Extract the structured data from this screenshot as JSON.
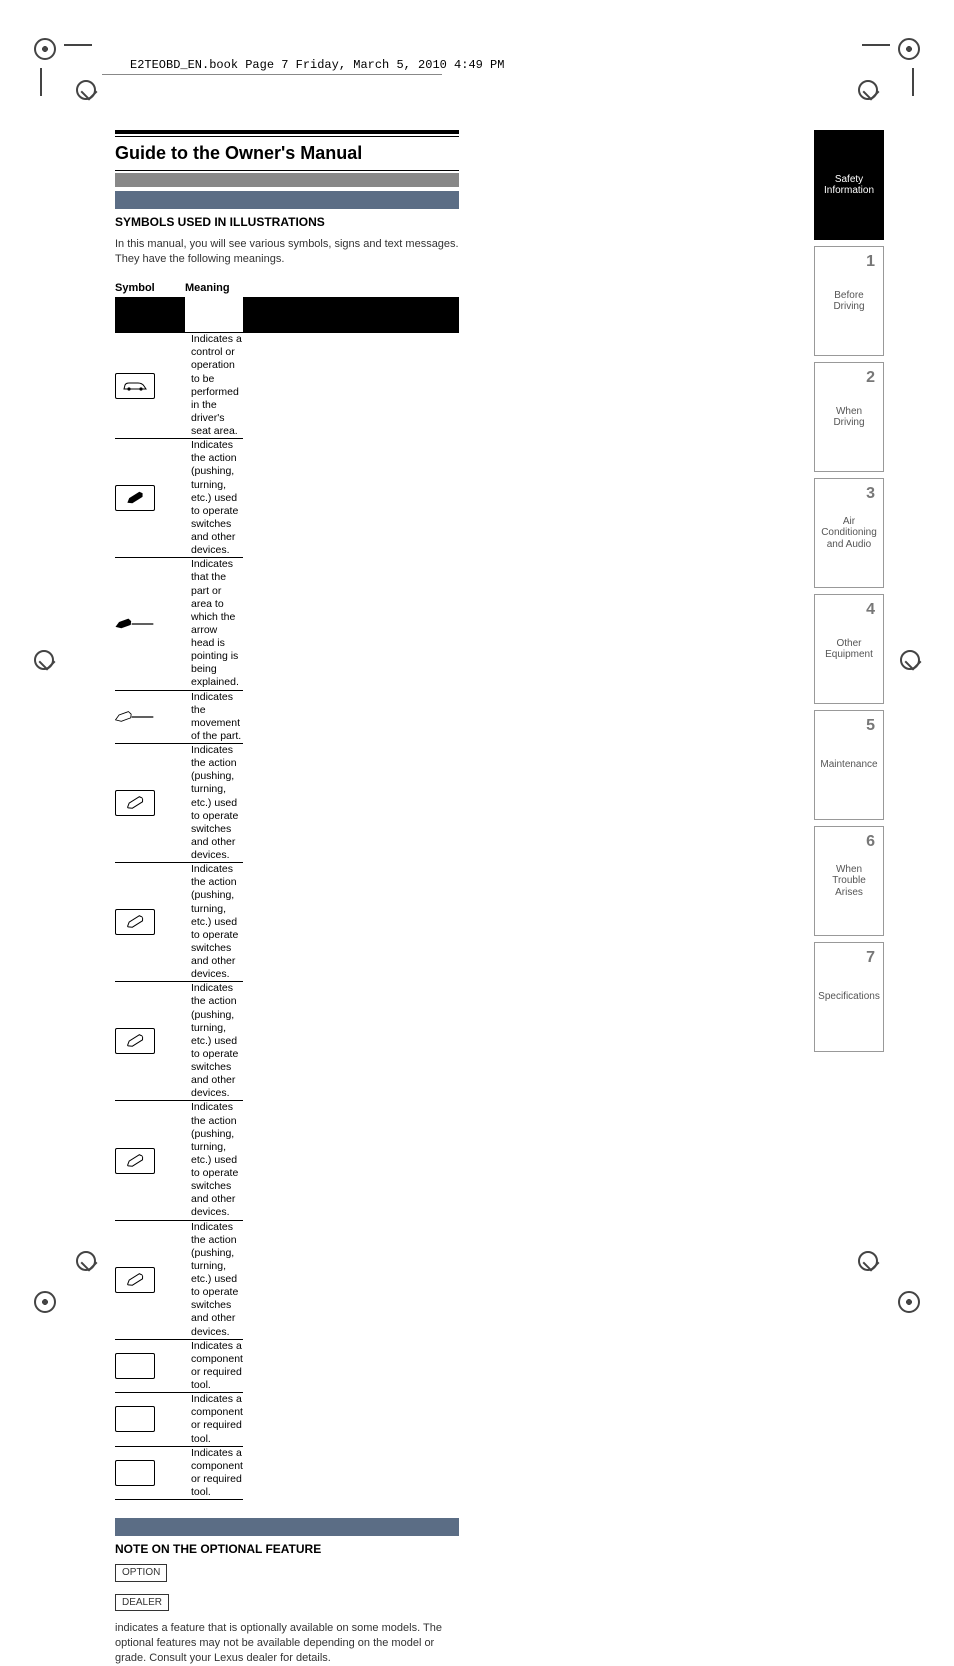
{
  "running_header": "E2TEOBD_EN.book  Page 7  Friday, March 5, 2010  4:49 PM",
  "title": "Guide to the Owner's Manual",
  "symbols_section": {
    "heading": "SYMBOLS USED IN ILLUSTRATIONS",
    "intro": "In this manual, you will see various symbols, signs and text messages. They have the following meanings.",
    "columns": {
      "symbol": "Symbol",
      "meaning": "Meaning"
    },
    "rows": [
      {
        "icon": "car",
        "meaning": "Indicates a control or operation to be performed in the driver's seat area."
      },
      {
        "icon": "pen-black",
        "meaning": "Indicates the action (pushing, turning, etc.) used to operate switches and other devices."
      },
      {
        "icon": "pen-line-1",
        "meaning": "Indicates that the part or area to which the arrow head is pointing is being explained."
      },
      {
        "icon": "pen-line-2",
        "meaning": "Indicates the movement of the part."
      },
      {
        "icon": "pen-orange",
        "meaning": "Indicates the action (pushing, turning, etc.) used to operate switches and other devices."
      },
      {
        "icon": "pen-yellow",
        "meaning": "Indicates the action (pushing, turning, etc.) used to operate switches and other devices."
      },
      {
        "icon": "pen-green",
        "meaning": "Indicates the action (pushing, turning, etc.) used to operate switches and other devices."
      },
      {
        "icon": "pen-blue",
        "meaning": "Indicates the action (pushing, turning, etc.) used to operate switches and other devices."
      },
      {
        "icon": "pen-purple",
        "meaning": "Indicates the action (pushing, turning, etc.) used to operate switches and other devices."
      },
      {
        "icon": "box-a",
        "meaning": "Indicates a component or required tool."
      },
      {
        "icon": "box-b",
        "meaning": "Indicates a component or required tool."
      },
      {
        "icon": "box-c",
        "meaning": "Indicates a component or required tool."
      }
    ]
  },
  "note_section": {
    "heading": "NOTE ON THE OPTIONAL FEATURE",
    "option_label": "OPTION",
    "dealer_label": "DEALER",
    "body": "indicates a feature that is optionally available on some models. The optional features may not be available depending on the model or grade. Consult your Lexus dealer for details."
  },
  "tabs": [
    {
      "num": "",
      "label": "Safety Information",
      "active": true
    },
    {
      "num": "1",
      "label": "Before Driving",
      "active": false
    },
    {
      "num": "2",
      "label": "When Driving",
      "active": false
    },
    {
      "num": "3",
      "label": "Air Conditioning and Audio",
      "active": false
    },
    {
      "num": "4",
      "label": "Other Equipment",
      "active": false
    },
    {
      "num": "5",
      "label": "Maintenance",
      "active": false
    },
    {
      "num": "6",
      "label": "When Trouble Arises",
      "active": false
    },
    {
      "num": "7",
      "label": "Specifications",
      "active": false
    }
  ],
  "page_number": "7"
}
